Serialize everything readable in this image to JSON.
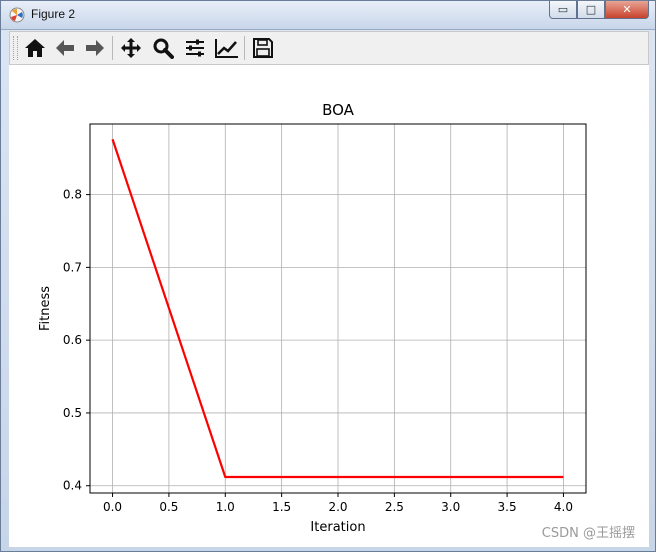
{
  "window": {
    "title": "Figure 2",
    "controls": {
      "minimize_glyph": "▭",
      "maximize_glyph": "□",
      "close_glyph": "✕"
    }
  },
  "toolbar": {
    "buttons": [
      {
        "name": "home-icon"
      },
      {
        "name": "back-arrow-icon"
      },
      {
        "name": "forward-arrow-icon"
      },
      {
        "name": "pan-icon"
      },
      {
        "name": "zoom-icon"
      },
      {
        "name": "configure-subplots-icon"
      },
      {
        "name": "edit-axis-icon"
      },
      {
        "name": "save-icon"
      }
    ]
  },
  "watermark": "CSDN @王摇摆",
  "chart_data": {
    "type": "line",
    "title": "BOA",
    "xlabel": "Iteration",
    "ylabel": "Fitness",
    "x": [
      0,
      1,
      2,
      3,
      4
    ],
    "series": [
      {
        "values": [
          0.876,
          0.412,
          0.412,
          0.412,
          0.412
        ],
        "color": "#ff0000"
      }
    ],
    "xlim": [
      -0.2,
      4.2
    ],
    "ylim": [
      0.39,
      0.897
    ],
    "xticks": [
      "0.0",
      "0.5",
      "1.0",
      "1.5",
      "2.0",
      "2.5",
      "3.0",
      "3.5",
      "4.0"
    ],
    "yticks": [
      "0.4",
      "0.5",
      "0.6",
      "0.7",
      "0.8"
    ],
    "grid": true,
    "legend": "none"
  }
}
